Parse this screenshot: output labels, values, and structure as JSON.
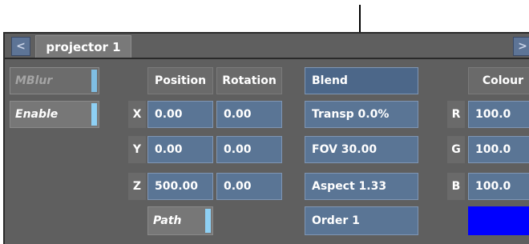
{
  "tab": {
    "title": "projector 1",
    "prev": "<",
    "next": ">"
  },
  "toggles": {
    "mblur": "MBlur",
    "enable": "Enable",
    "path": "Path"
  },
  "transform": {
    "position_header": "Position",
    "rotation_header": "Rotation",
    "rows": [
      {
        "axis": "X",
        "position": "0.00",
        "rotation": "0.00"
      },
      {
        "axis": "Y",
        "position": "0.00",
        "rotation": "0.00"
      },
      {
        "axis": "Z",
        "position": "500.00",
        "rotation": "0.00"
      }
    ]
  },
  "projection": {
    "blend": "Blend",
    "transp": "Transp 0.0%",
    "fov": "FOV 30.00",
    "aspect": "Aspect 1.33",
    "order": "Order 1"
  },
  "colour": {
    "header": "Colour",
    "rows": [
      {
        "channel": "R",
        "value": "100.0"
      },
      {
        "channel": "G",
        "value": "100.0"
      },
      {
        "channel": "B",
        "value": "100.0"
      }
    ],
    "swatch_color": "#0000ff"
  }
}
